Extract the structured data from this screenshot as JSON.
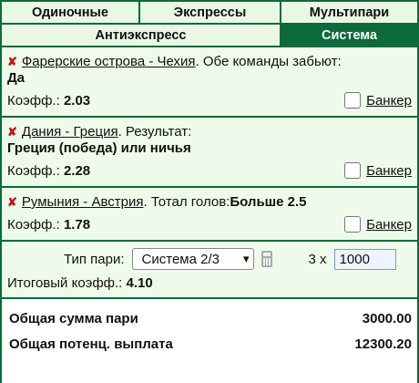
{
  "tabs": {
    "row1": [
      "Одиночные",
      "Экспрессы",
      "Мультипари"
    ],
    "row2": [
      "Антиэкспресс",
      "Система"
    ],
    "active": "Система"
  },
  "bets": [
    {
      "match": "Фарерские острова - Чехия",
      "market": ". Обе команды забьют:",
      "selection": "Да",
      "odds_label": "Коэфф.:",
      "odds": "2.03",
      "banker_label": "Банкер"
    },
    {
      "match": "Дания - Греция",
      "market": ". Результат:",
      "selection": "Греция (победа) или ничья",
      "odds_label": "Коэфф.:",
      "odds": "2.28",
      "banker_label": "Банкер"
    },
    {
      "match": "Румыния - Австрия",
      "market": ". Тотал голов:",
      "selection": "Больше 2.5",
      "odds_label": "Коэфф.:",
      "odds": "1.78",
      "banker_label": "Банкер"
    }
  ],
  "settings": {
    "type_label": "Тип пари:",
    "type_value": "Система 2/3",
    "multiplier": "3 x",
    "stake": "1000",
    "total_odds_label": "Итоговый коэфф.:",
    "total_odds": "4.10"
  },
  "summary": {
    "total_stake_label": "Общая сумма пари",
    "total_stake": "3000.00",
    "potential_label": "Общая потенц. выплата",
    "potential": "12300.20"
  },
  "colors": {
    "accent_green": "#0d6a3a",
    "light_green": "#eefbea",
    "remove_red": "#c01414"
  }
}
